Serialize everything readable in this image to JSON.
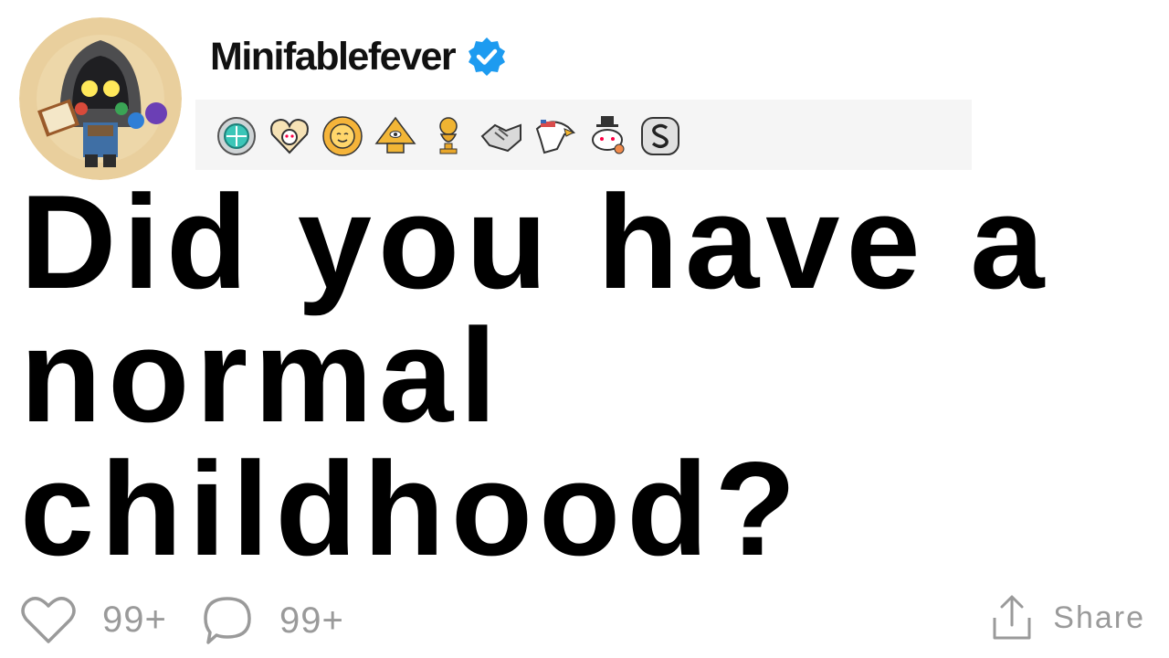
{
  "post": {
    "username": "Minifablefever",
    "verified": true,
    "title": "Did you have a normal childhood?"
  },
  "awards": [
    {
      "icon": "gem-badge-icon"
    },
    {
      "icon": "heart-snoo-icon"
    },
    {
      "icon": "sun-face-icon"
    },
    {
      "icon": "golden-pyramid-icon"
    },
    {
      "icon": "gold-trophy-snoo-icon"
    },
    {
      "icon": "handshake-icon"
    },
    {
      "icon": "eagle-icon"
    },
    {
      "icon": "top-hat-snoo-icon"
    },
    {
      "icon": "silver-s-icon"
    }
  ],
  "stats": {
    "likes": "99+",
    "comments": "99+",
    "share_label": "Share"
  },
  "colors": {
    "verified_blue": "#1d9bf0",
    "stat_gray": "#9a9a9a",
    "awards_bg": "#f5f5f5"
  }
}
